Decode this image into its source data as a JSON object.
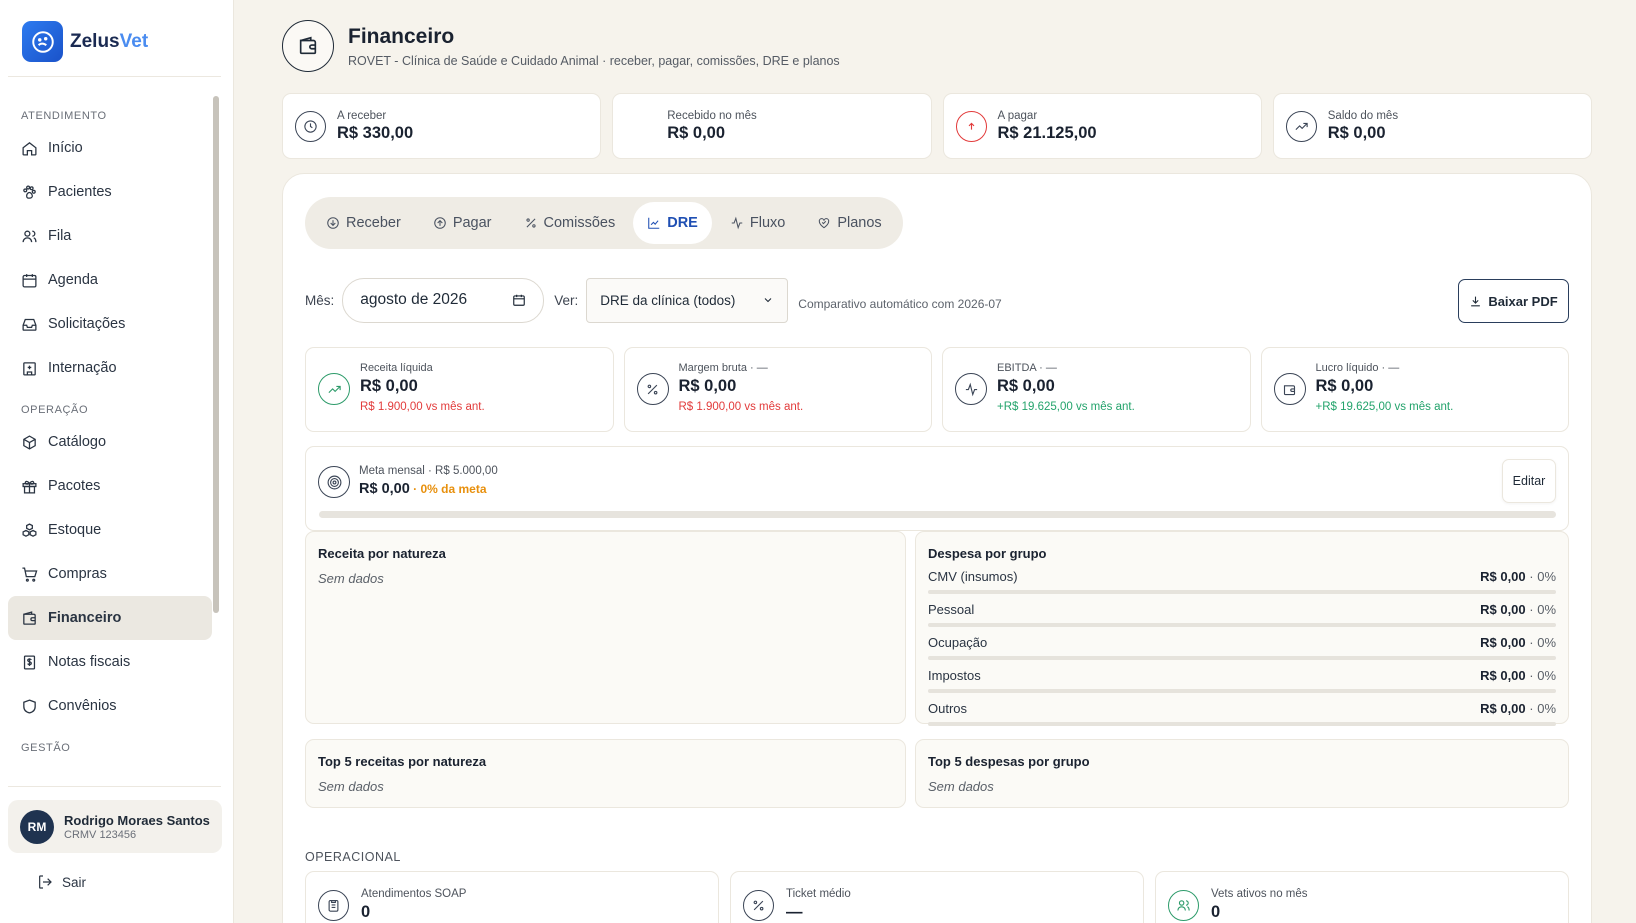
{
  "brand": {
    "name_main": "Zelus",
    "name_accent": "Vet"
  },
  "sidebar": {
    "sections": {
      "atendimento": "ATENDIMENTO",
      "operacao": "OPERAÇÃO",
      "gestao": "GESTÃO"
    },
    "items": [
      {
        "label": "Início",
        "icon": "home-icon"
      },
      {
        "label": "Pacientes",
        "icon": "paw-icon"
      },
      {
        "label": "Fila",
        "icon": "users-icon"
      },
      {
        "label": "Agenda",
        "icon": "calendar-icon"
      },
      {
        "label": "Solicitações",
        "icon": "inbox-icon"
      },
      {
        "label": "Internação",
        "icon": "hospital-icon"
      },
      {
        "label": "Catálogo",
        "icon": "box-icon"
      },
      {
        "label": "Pacotes",
        "icon": "gift-icon"
      },
      {
        "label": "Estoque",
        "icon": "boxes-icon"
      },
      {
        "label": "Compras",
        "icon": "cart-icon"
      },
      {
        "label": "Financeiro",
        "icon": "wallet-icon",
        "active": true
      },
      {
        "label": "Notas fiscais",
        "icon": "receipt-icon"
      },
      {
        "label": "Convênios",
        "icon": "shield-icon"
      }
    ],
    "user": {
      "initials": "RM",
      "name": "Rodrigo Moraes Santos",
      "sub": "CRMV 123456"
    },
    "logout": "Sair"
  },
  "header": {
    "title": "Financeiro",
    "subtitle": "ROVET - Clínica de Saúde e Cuidado Animal · receber, pagar, comissões, DRE e planos"
  },
  "kpis": [
    {
      "label": "A receber",
      "value": "R$ 330,00"
    },
    {
      "label": "Recebido no mês",
      "value": "R$ 0,00"
    },
    {
      "label": "A pagar",
      "value": "R$ 21.125,00"
    },
    {
      "label": "Saldo do mês",
      "value": "R$ 0,00"
    }
  ],
  "tabs": [
    {
      "label": "Receber"
    },
    {
      "label": "Pagar"
    },
    {
      "label": "Comissões"
    },
    {
      "label": "DRE",
      "active": true
    },
    {
      "label": "Fluxo"
    },
    {
      "label": "Planos"
    }
  ],
  "filters": {
    "month_label": "Mês:",
    "month_value": "agosto de 2026",
    "view_label": "Ver:",
    "view_value": "DRE da clínica (todos)",
    "hint": "Comparativo automático com 2026-07",
    "pdf_button": "Baixar PDF"
  },
  "metrics": [
    {
      "label": "Receita líquida",
      "value": "R$ 0,00",
      "delta": "R$ 1.900,00 vs mês ant."
    },
    {
      "label": "Margem bruta · —",
      "value": "R$ 0,00",
      "delta": "R$ 1.900,00 vs mês ant."
    },
    {
      "label": "EBITDA · —",
      "value": "R$ 0,00",
      "delta": "+R$ 19.625,00 vs mês ant."
    },
    {
      "label": "Lucro líquido · —",
      "value": "R$ 0,00",
      "delta": "+R$ 19.625,00 vs mês ant."
    }
  ],
  "goal": {
    "label": "Meta mensal · R$ 5.000,00",
    "value": "R$ 0,00",
    "pct": " · 0% da meta",
    "progress": 0,
    "edit_button": "Editar"
  },
  "revenue_nature": {
    "title": "Receita por natureza",
    "empty": "Sem dados"
  },
  "expense_group": {
    "title": "Despesa por grupo",
    "rows": [
      {
        "name": "CMV (insumos)",
        "value": "R$ 0,00",
        "pct": " · 0%"
      },
      {
        "name": "Pessoal",
        "value": "R$ 0,00",
        "pct": " · 0%"
      },
      {
        "name": "Ocupação",
        "value": "R$ 0,00",
        "pct": " · 0%"
      },
      {
        "name": "Impostos",
        "value": "R$ 0,00",
        "pct": " · 0%"
      },
      {
        "name": "Outros",
        "value": "R$ 0,00",
        "pct": " · 0%"
      }
    ]
  },
  "top_revenue": {
    "title": "Top 5 receitas por natureza",
    "empty": "Sem dados"
  },
  "top_expense": {
    "title": "Top 5 despesas por grupo",
    "empty": "Sem dados"
  },
  "operational": {
    "label": "OPERACIONAL",
    "items": [
      {
        "label": "Atendimentos SOAP",
        "value": "0"
      },
      {
        "label": "Ticket médio",
        "value": "—"
      },
      {
        "label": "Vets ativos no mês",
        "value": "0"
      }
    ]
  },
  "colors": {
    "accent": "#1f4fb3",
    "negative": "#e23b3b",
    "positive": "#23a36b",
    "warning": "#e8900d"
  }
}
